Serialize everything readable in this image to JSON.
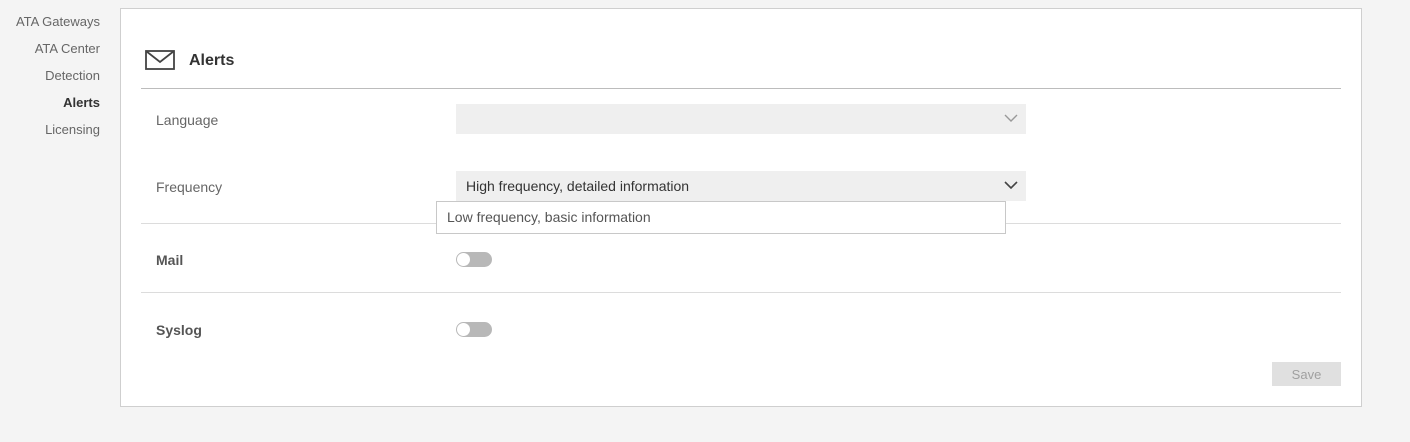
{
  "sidebar": {
    "items": [
      {
        "label": "ATA Gateways",
        "active": false
      },
      {
        "label": "ATA Center",
        "active": false
      },
      {
        "label": "Detection",
        "active": false
      },
      {
        "label": "Alerts",
        "active": true
      },
      {
        "label": "Licensing",
        "active": false
      }
    ]
  },
  "panel": {
    "title": "Alerts",
    "icon": "mail-icon"
  },
  "language": {
    "label": "Language",
    "value": ""
  },
  "frequency": {
    "label": "Frequency",
    "selected": "High frequency, detailed information",
    "options": [
      "Low frequency, basic information"
    ]
  },
  "mail": {
    "label": "Mail",
    "enabled": false
  },
  "syslog": {
    "label": "Syslog",
    "enabled": false
  },
  "actions": {
    "save_label": "Save"
  },
  "colors": {
    "background": "#f4f4f4",
    "panel": "#ffffff",
    "toggle_off": "#b8b8b8",
    "select_bg": "#efefef"
  }
}
